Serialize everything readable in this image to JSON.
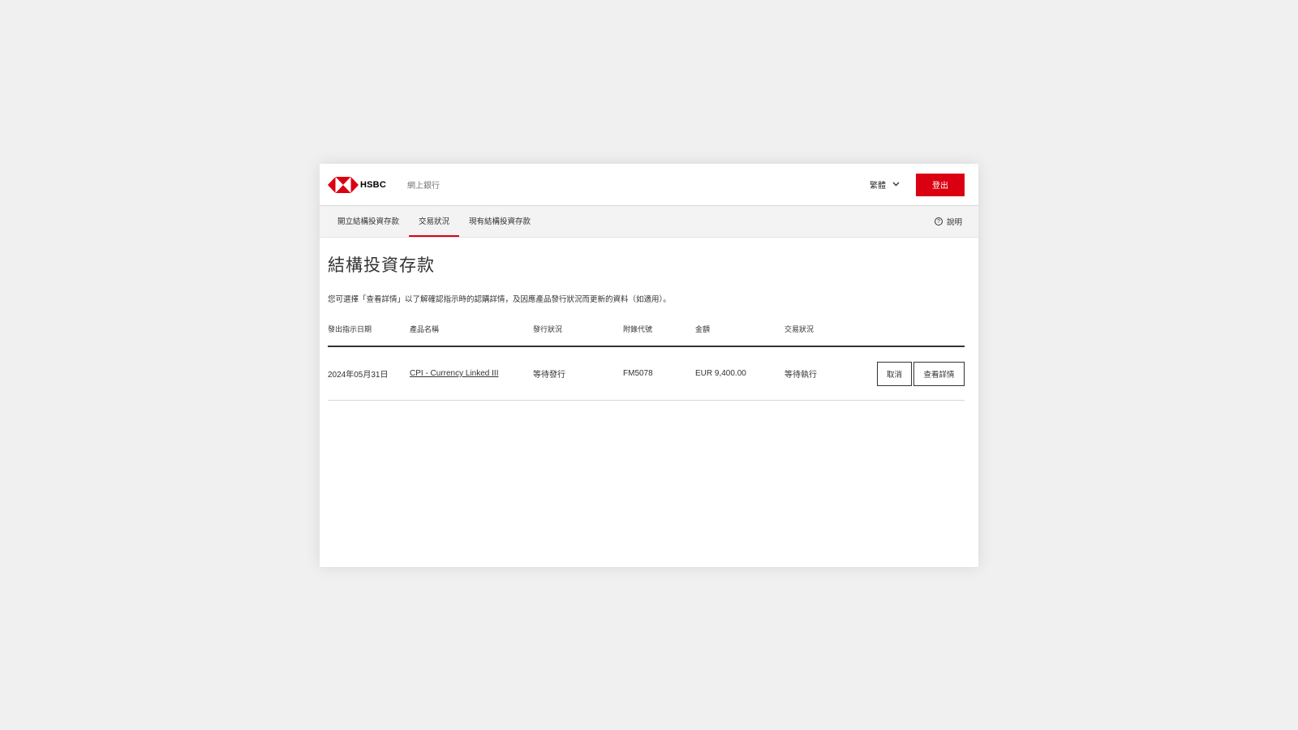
{
  "header": {
    "brand": "HSBC",
    "app_name": "網上銀行",
    "language": "繁體",
    "logout_label": "登出"
  },
  "nav": {
    "tabs": [
      {
        "label": "開立結構投資存款",
        "active": false
      },
      {
        "label": "交易狀況",
        "active": true
      },
      {
        "label": "現有結構投資存款",
        "active": false
      }
    ],
    "help_label": "說明"
  },
  "main": {
    "title": "結構投資存款",
    "description": "您可選擇「查看詳情」以了解確認指示時的認購詳情，及因應產品發行狀況而更新的資料（如適用）。",
    "table": {
      "columns": [
        "發出指示日期",
        "產品名稱",
        "發行狀況",
        "附錄代號",
        "金額",
        "交易狀況",
        ""
      ],
      "rows": [
        {
          "date": "2024年05月31日",
          "product": "CPI - Currency Linked III",
          "issue_status": "等待發行",
          "ref_code": "FM5078",
          "amount": "EUR 9,400.00",
          "txn_status": "等待執行",
          "cancel_label": "取消",
          "view_label": "查看詳情"
        }
      ]
    }
  },
  "colors": {
    "brand_red": "#db0011",
    "text": "#333333",
    "nav_bg": "#f3f3f3",
    "page_bg": "#f0f0f0"
  },
  "icons": {
    "logo": "hsbc-hexagon-logo",
    "language_chevron": "chevron-down-icon",
    "help": "help-circle-icon"
  }
}
